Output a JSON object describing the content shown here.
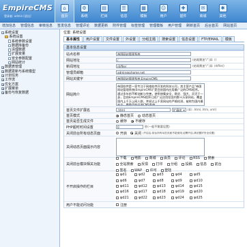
{
  "header": {
    "logo": "EmpireCMS",
    "user": "登录者: admin  [退出]"
  },
  "nav": [
    "首页",
    "系统",
    "栏目",
    "信息",
    "模板",
    "用户",
    "插件",
    "商城",
    "其他"
  ],
  "subnav": [
    "增加信息",
    "管理信息",
    "审核信息",
    "签发信息",
    "管理评论",
    "数据更新",
    "附件管理",
    "标签管理",
    "管理模板",
    "用户管理",
    "刷新首页",
    "后台首页",
    "网站首页"
  ],
  "sidebar": [
    {
      "t": "系统设置",
      "lv": 0,
      "k": "pm"
    },
    {
      "t": "系统设置",
      "lv": 1,
      "k": "fi"
    },
    {
      "t": "系统参数设置",
      "lv": 2,
      "k": "pg"
    },
    {
      "t": "数据库备份",
      "lv": 2,
      "k": "pg"
    },
    {
      "t": "清理数据",
      "lv": 2,
      "k": "pg"
    },
    {
      "t": "扩展变量",
      "lv": 2,
      "k": "pg"
    },
    {
      "t": "安全参数配置",
      "lv": 2,
      "k": "pg"
    },
    {
      "t": "网站统计",
      "lv": 2,
      "k": "pg"
    },
    {
      "t": "数据表管理",
      "lv": 0,
      "k": "pm"
    },
    {
      "t": "数据更新与系统模型",
      "lv": 0,
      "k": "pm"
    },
    {
      "t": "计划任务",
      "lv": 0,
      "k": "pm"
    },
    {
      "t": "工作流",
      "lv": 0,
      "k": "pm"
    },
    {
      "t": "优化方案",
      "lv": 0,
      "k": "pm"
    },
    {
      "t": "扩展菜单",
      "lv": 0,
      "k": "pm"
    },
    {
      "t": "备份与恢复数据",
      "lv": 0,
      "k": "pm"
    }
  ],
  "main": {
    "breadcrumb": "位置: 系统设置",
    "tabs": [
      "基本属性",
      "用户设置",
      "文件设置",
      "外设置",
      "分组主题",
      "搜索设置",
      "信息设置",
      "FTP/EMAIL",
      "模板"
    ],
    "section": "基本信息设置",
    "site_name": {
      "label": "站点名称",
      "value": "帝国网站管理系统"
    },
    "site_url": {
      "label": "网站地址",
      "value": "/",
      "note": "(结尾需加\"/\",如: /)"
    },
    "news_url": {
      "label": "新闻地址",
      "value": "/d/file/",
      "note": "(结尾需加\"/\",如: /d/file/)"
    },
    "email": {
      "label": "管理员邮箱",
      "value": "admin@phome.net"
    },
    "keywords": {
      "label": "网站关键字",
      "value": "帝国网站管理系统,EmpireCMS"
    },
    "intro": {
      "label": "网站简介",
      "value": "帝国软件是一家专注于网络软件开发的科技公司，其主营产品\"帝国网站管理系统(EmpireCMS)\"是目前国内应用最广泛的CMS程序。通过多年的不断创新与完善，使系统集安全、稳定、强大、灵活于一身，目前EmpireCMS程序已经广泛应用在国内数十万家网站，覆盖国内上千万上网人群，并经过上千家网站的严格检测，被称为国内最安全、最稳定的开源CMS系统。"
    },
    "homepage_ext": {
      "label": "首页文件扩展名",
      "value": ".html",
      "select": "扩展名",
      "note": "(如: .html,.htm,.xml)"
    },
    "homepage_mode": {
      "label": "首页模式",
      "opt1": "静态首页",
      "opt2": "动态首页"
    },
    "rewrite": {
      "label": "首页是否生成文件",
      "opt1": "缓存",
      "opt2": "不缓存"
    },
    "php_time": {
      "label": "PHP超时时间设置",
      "value": "0",
      "note": "秒(一般不需要设置)"
    },
    "close_all": {
      "label": "关闭前台所有动态页面",
      "opt1": "开启",
      "opt2": "关闭",
      "note": "(开启后,前台所有动态页面不能使用,如需开启,请设置好安全设置)"
    },
    "close_notice": {
      "label": "关闭动态页面提示内容"
    },
    "close_modules": {
      "label": "关闭前台模块相关功能",
      "items": [
        "下载",
        "电影",
        "商城",
        "会员",
        "评论",
        "RSS",
        "搜索",
        "全站搜索",
        "反馈",
        "打印",
        "分组",
        "投稿",
        "信息",
        "前台",
        "签名",
        "WAP",
        "许可",
        "登陆"
      ]
    },
    "no_cats": {
      "label": "不开启操作的栏目",
      "items": [
        "ψd1",
        "ψd2",
        "ψd3",
        "ψd4",
        "ψd5",
        "ψd6",
        "ψd7",
        "ψd8",
        "ψd9",
        "ψd10",
        "ψd11",
        "ψd12",
        "ψd13",
        "ψd14",
        "ψd15",
        "ψd16",
        "ψd17",
        "ψd18",
        "ψd19",
        "ψd20",
        "ψd21",
        "ψd22",
        "ψd23",
        "ψd24",
        "ψd25"
      ]
    },
    "extra": {
      "label": "用户不能访问功能",
      "value": "注册"
    }
  }
}
